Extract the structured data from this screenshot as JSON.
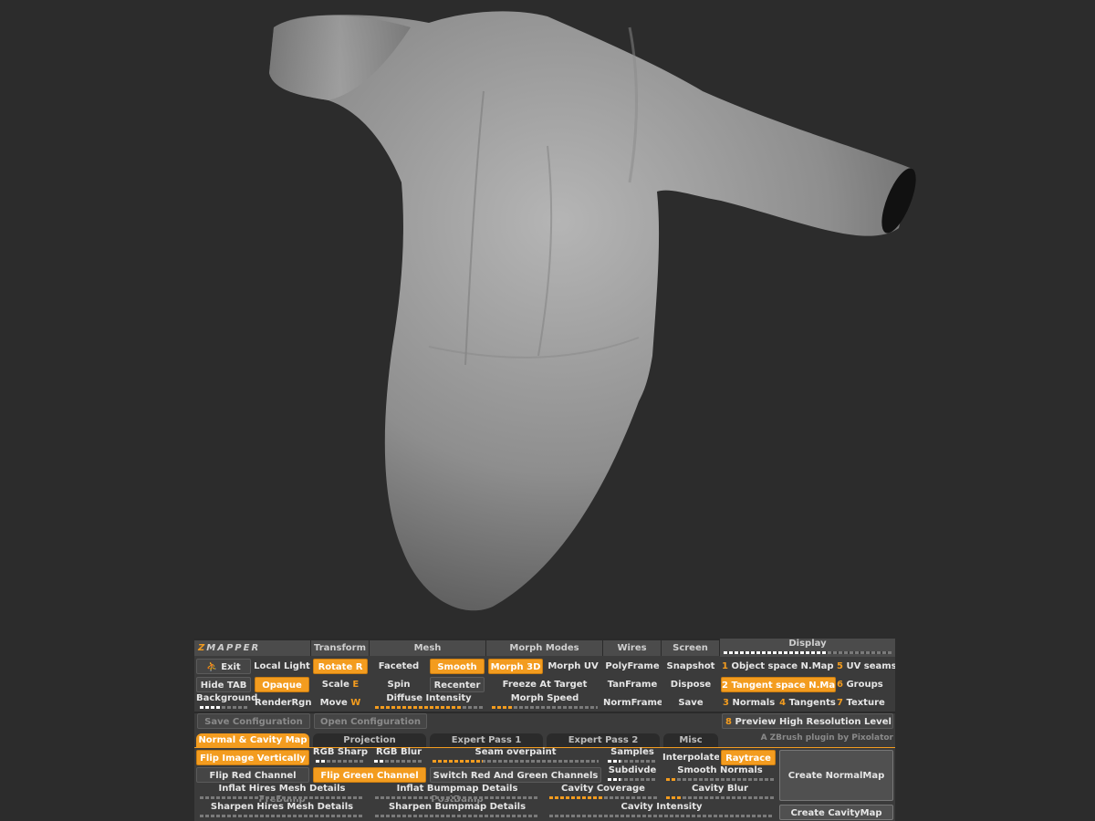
{
  "header": {
    "title_first": "Z",
    "title_rest": "MAPPER",
    "transform": "Transform",
    "mesh": "Mesh",
    "morph_modes": "Morph Modes",
    "wires": "Wires",
    "screen": "Screen",
    "display": "Display"
  },
  "row1": {
    "exit": "Exit",
    "local_light": "Local Light",
    "rotate": "Rotate",
    "rotate_key": "R",
    "faceted": "Faceted",
    "smooth": "Smooth",
    "morph3d": "Morph 3D",
    "morph_uv": "Morph UV",
    "polyframe": "PolyFrame",
    "snapshot": "Snapshot",
    "obj_space_num": "1",
    "obj_space": "Object space N.Map",
    "uv_seams_num": "5",
    "uv_seams": "UV seams"
  },
  "row2": {
    "hide_tab": "Hide TAB",
    "opaque": "Opaque",
    "scale": "Scale",
    "scale_key": "E",
    "spin": "Spin",
    "recenter": "Recenter",
    "freeze": "Freeze At Target",
    "tanframe": "TanFrame",
    "dispose": "Dispose",
    "tangent_space": "2 Tangent space N.Map",
    "groups_num": "6",
    "groups": "Groups"
  },
  "row3": {
    "background": "Background",
    "render_rgn": "RenderRgn",
    "move": "Move",
    "move_key": "W",
    "diffuse": "Diffuse Intensity",
    "morph_speed": "Morph Speed",
    "normframe": "NormFrame",
    "save": "Save",
    "normals_num": "3",
    "normals": "Normals",
    "tangents_num": "4",
    "tangents": "Tangents",
    "texture_num": "7",
    "texture": "Texture"
  },
  "config": {
    "save_config": "Save Configuration",
    "open_config": "Open Configuration",
    "preview_num": "8",
    "preview": "Preview High Resolution Level",
    "credit": "A ZBrush plugin by Pixolator"
  },
  "tabs": [
    "Normal & Cavity Map",
    "Projection",
    "Expert Pass 1",
    "Expert Pass 2",
    "Misc"
  ],
  "options": {
    "flip_vert": "Flip Image Vertically",
    "rgb_sharp": "RGB Sharp",
    "rgb_blur": "RGB Blur",
    "seam_overpaint": "Seam overpaint",
    "samples": "Samples",
    "interpolate": "Interpolate",
    "raytrace": "Raytrace",
    "flip_red": "Flip Red Channel",
    "flip_green": "Flip Green Channel",
    "switch_rg": "Switch Red And Green Channels",
    "subdivide": "Subdivde",
    "smooth_normals": "Smooth Normals",
    "inflat_hires": "Inflat Hires Mesh Details",
    "prebump": "PreBump",
    "inflat_bump": "Inflat Bumpmap Details",
    "postbump": "PostBump",
    "cavity_coverage": "Cavity Coverage",
    "cavity_blur": "Cavity Blur",
    "sharpen_hires": "Sharpen Hires Mesh Details",
    "sharpen_bump": "Sharpen Bumpmap Details",
    "cavity_intensity": "Cavity Intensity",
    "create_normal": "Create NormalMap",
    "create_cavity": "Create CavityMap"
  },
  "levels": {
    "display": 0.62,
    "background": 0.45,
    "diffuse": 0.8,
    "morph_speed": 0.2,
    "seam": 0.3,
    "samples": 0.25,
    "subdivide": 0.25,
    "smooth_normals": 0.1,
    "inflat_hires": 0.0,
    "inflat_bump": 0.0,
    "cavity_coverage": 0.5,
    "cavity_blur": 0.15,
    "sharpen_hires": 0.0,
    "sharpen_bump": 0.0,
    "cavity_intensity": 0.0
  },
  "colors": {
    "accent": "#f39c1f",
    "panel": "#3b3b3b",
    "viewport": "#2c2c2c"
  }
}
